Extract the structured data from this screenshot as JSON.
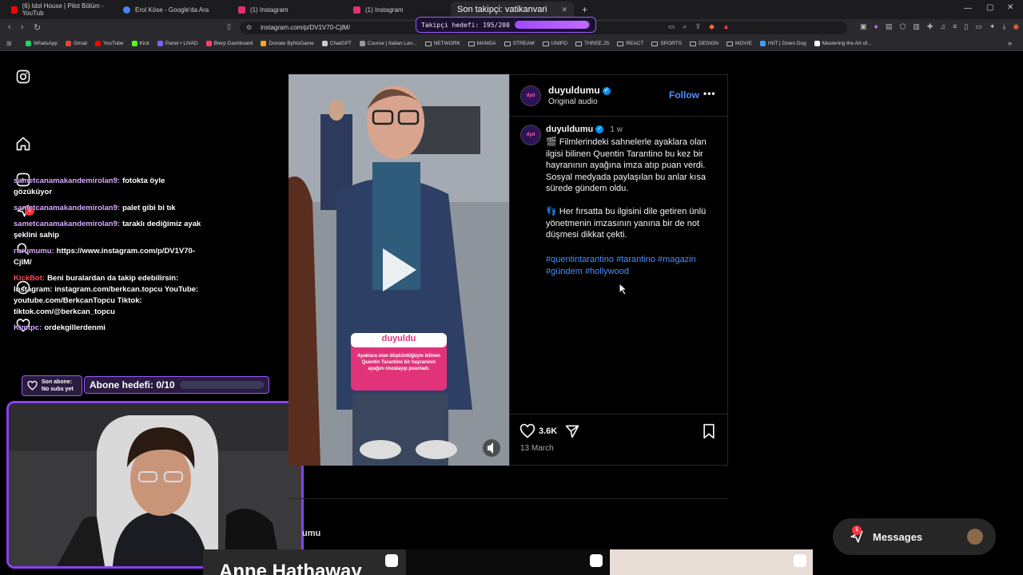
{
  "browser": {
    "tabs": [
      {
        "title": "(6) Idol House | Pilot Bölüm - YouTub",
        "favicon_color": "#ff0000"
      },
      {
        "title": "Erol Köse - Google'da Ara",
        "favicon_color": "#4285f4"
      },
      {
        "title": "(1) Instagram",
        "favicon_color": "#e1306c"
      },
      {
        "title": "(1) Instagram",
        "favicon_color": "#e1306c"
      },
      {
        "title": "Son takipçi: vatikanvari",
        "favicon_color": "#e1306c"
      }
    ],
    "new_tab": "+",
    "url": "instagram.com/p/DV1V70-CjlM/",
    "bookmarks": [
      {
        "label": "WhatsApp",
        "type": "site",
        "color": "#25d366"
      },
      {
        "label": "Gmail",
        "type": "site",
        "color": "#ea4335"
      },
      {
        "label": "YouTube",
        "type": "site",
        "color": "#ff0000"
      },
      {
        "label": "Kick",
        "type": "site",
        "color": "#53fc18"
      },
      {
        "label": "Panel • LIVAD",
        "type": "site",
        "color": "#7b61ff"
      },
      {
        "label": "Blerp Dashboard",
        "type": "site",
        "color": "#ff3e6c"
      },
      {
        "label": "Donate ByNoGame",
        "type": "site",
        "color": "#f5a623"
      },
      {
        "label": "ChatGPT",
        "type": "site",
        "color": "#cccccc"
      },
      {
        "label": "Course | Italian Lan...",
        "type": "site",
        "color": "#999999"
      },
      {
        "label": "NETWORK",
        "type": "folder"
      },
      {
        "label": "MANGA",
        "type": "folder"
      },
      {
        "label": "STREAM",
        "type": "folder"
      },
      {
        "label": "UNIPD",
        "type": "folder"
      },
      {
        "label": "THREE.JS",
        "type": "folder"
      },
      {
        "label": "REACT",
        "type": "folder"
      },
      {
        "label": "SPORTS",
        "type": "folder"
      },
      {
        "label": "DESIGN",
        "type": "folder"
      },
      {
        "label": "MOVIE",
        "type": "folder"
      },
      {
        "label": "HIIT | Down Dog",
        "type": "site",
        "color": "#3ba1ff"
      },
      {
        "label": "Mastering the Art of...",
        "type": "site",
        "color": "#ffffff"
      }
    ],
    "bookmarks_more": "»"
  },
  "stream_overlay": {
    "follower_goal_label": "Takipçi hedefi: 195/200",
    "follower_goal_fraction": 0.975,
    "chat": [
      {
        "user": "sametcanamakandemirolan9:",
        "text": "fotokta öyle gözüküyor",
        "kick": false
      },
      {
        "user": "sametcanamakandemirolan9:",
        "text": "palet gibi bi tık",
        "kick": false
      },
      {
        "user": "sametcanamakandemirolan9:",
        "text": "taraklı dediğimiz ayak şeklini sahip",
        "kick": false
      },
      {
        "user": "rurumumu:",
        "text": "https://www.instagram.com/p/DV1V70-CjlM/",
        "kick": false
      },
      {
        "user": "KickBot:",
        "text": "Beni buralardan da takip edebilirsin: Instagram: instagram.com/berkcan.topcu YouTube: youtube.com/BerkcanTopcu Tiktok: tiktok.com/@berkcan_topcu",
        "kick": true
      },
      {
        "user": "Kimtpc:",
        "text": "ordekgillerdenmi",
        "kick": false
      }
    ],
    "last_sub_title": "Son abone:",
    "last_sub_value": "No subs yet",
    "sub_goal_label": "Abone hedefi: 0/10",
    "sub_goal_fraction": 0
  },
  "post": {
    "username": "duyuldumu",
    "audio": "Original audio",
    "follow": "Follow",
    "avatar_text": "dyd",
    "time": "1 w",
    "caption_lines": [
      "🎬 Filmlerindeki sahnelerle ayaklara olan ilgisi bilinen Quentin Tarantino bu kez bir hayranının ayağına imza atıp puan verdi. Sosyal medyada paylaşılan bu anlar kısa sürede gündem oldu.",
      "👣 Her fırsatta bu ilgisini dile getiren ünlü yönetmenin imzasının yanına bir de not düşmesi dikkat çekti."
    ],
    "hashtags": "#quentintarantino #tarantino #magazin #gündem #hollywood",
    "likes": "3.6K",
    "date": "13 March",
    "video_logo": "duyuldu",
    "video_caption": "Ayaklara olan düşkünlüğüyle bilinen Quentin Tarantino bir hayranının ayağını imzalayıp puanladı."
  },
  "below": {
    "more_from": "umu",
    "thumb_text": "Anne Hathaway"
  },
  "messages": {
    "label": "Messages",
    "badge": "1"
  },
  "nav_badge": "1"
}
